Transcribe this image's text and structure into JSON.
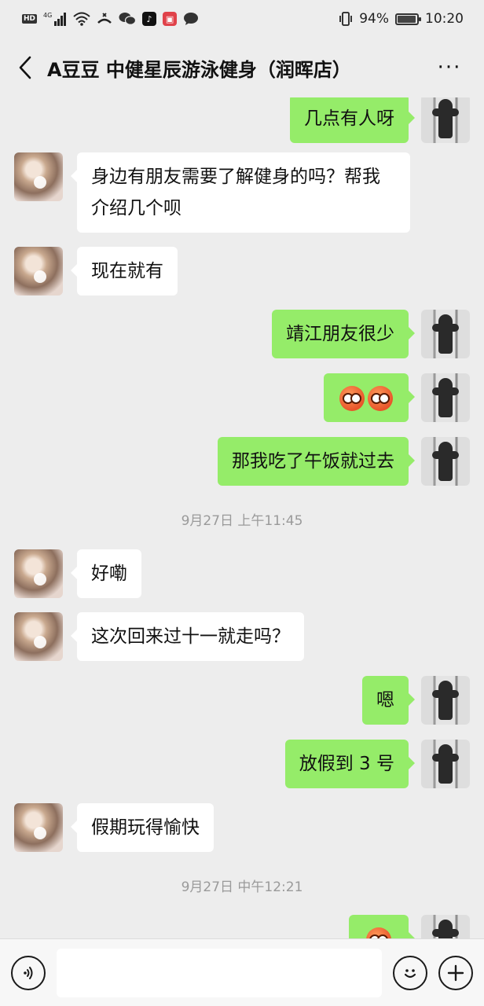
{
  "status_bar": {
    "hd": "HD",
    "network": "4G",
    "battery_percent": "94%",
    "battery_level": 0.94,
    "time": "10:20",
    "icons": [
      "hd-icon",
      "signal-icon",
      "wifi-icon",
      "missed-call-icon",
      "wechat-icon",
      "tiktok-icon",
      "red-app-icon",
      "message-icon",
      "vibrate-icon",
      "battery-icon"
    ]
  },
  "header": {
    "title": "A豆豆 中健星辰游泳健身（润晖店）",
    "back_icon": "chevron-left-icon",
    "more_label": "···"
  },
  "messages": [
    {
      "side": "right",
      "text": "几点有人呀"
    },
    {
      "side": "left",
      "text": "身边有朋友需要了解健身的吗？帮我介绍几个呗"
    },
    {
      "side": "left",
      "text": "现在就有"
    },
    {
      "side": "right",
      "text": "靖江朋友很少"
    },
    {
      "side": "right",
      "emoji": [
        "flushed-emoji",
        "flushed-emoji"
      ]
    },
    {
      "side": "right",
      "text": "那我吃了午饭就过去"
    },
    {
      "timestamp": "9月27日 上午11:45"
    },
    {
      "side": "left",
      "text": "好嘞"
    },
    {
      "side": "left",
      "text": "这次回来过十一就走吗？"
    },
    {
      "side": "right",
      "text": "嗯"
    },
    {
      "side": "right",
      "text": "放假到 3 号"
    },
    {
      "side": "left",
      "text": "假期玩得愉快"
    },
    {
      "timestamp": "9月27日 中午12:21"
    },
    {
      "side": "right",
      "emoji": [
        "flushed-emoji"
      ]
    }
  ],
  "input_bar": {
    "voice_icon": "voice-icon",
    "emoji_icon": "emoji-icon",
    "plus_icon": "plus-icon",
    "input_value": ""
  },
  "colors": {
    "background": "#ededed",
    "my_bubble": "#95ec69",
    "their_bubble": "#ffffff",
    "timestamp": "#9a9a9a"
  }
}
